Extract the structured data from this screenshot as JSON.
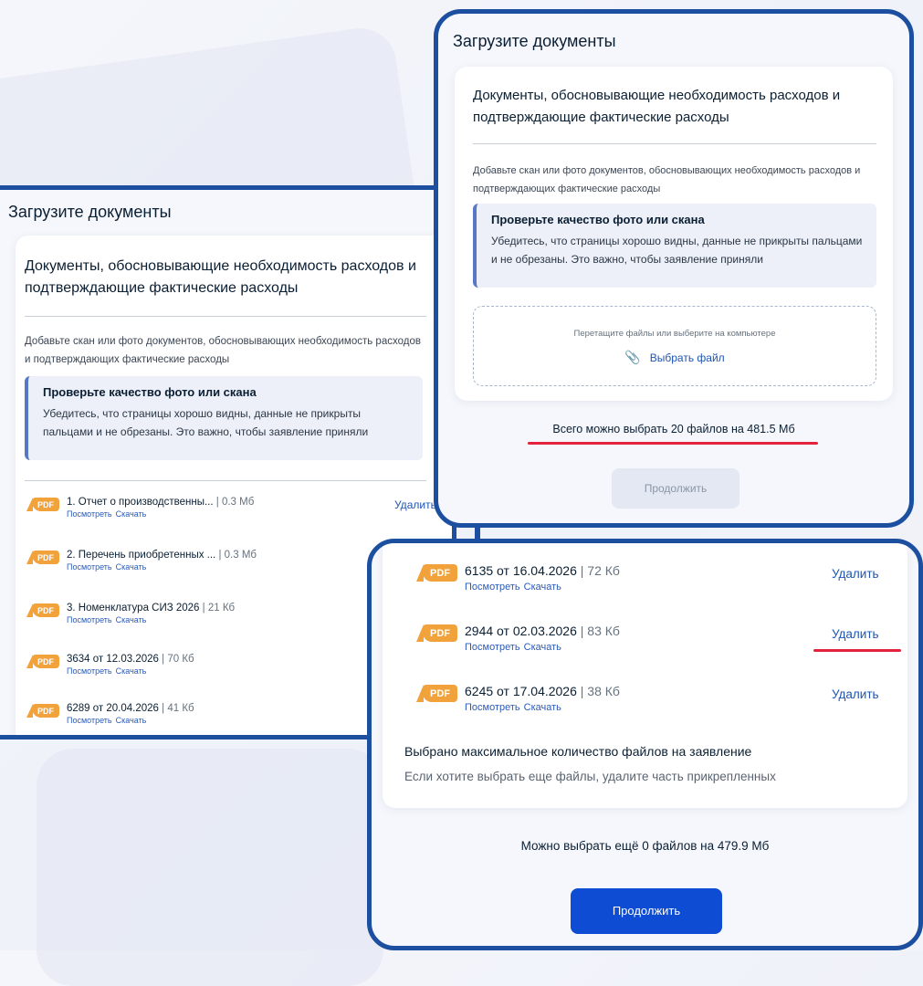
{
  "left_panel": {
    "title": "Загрузите документы",
    "subtitle": "Документы, обосновывающие необходимость расходов и подтверждающие фактические расходы",
    "description": "Добавьте скан или фото документов, обосновывающих необходимость расходов и подтверждающих фактические расходы",
    "notice": {
      "title": "Проверьте качество фото или скана",
      "text": "Убедитесь, что страницы хорошо видны, данные не прикрыты пальцами и не обрезаны. Это важно, чтобы заявление приняли"
    },
    "files": [
      {
        "badge": "PDF",
        "name": "1. Отчет о производственны...",
        "size": " | 0.3 Мб",
        "view": "Посмотреть",
        "download": "Скачать",
        "delete": "Удалить"
      },
      {
        "badge": "PDF",
        "name": "2. Перечень приобретенных ...",
        "size": " | 0.3 Мб",
        "view": "Посмотреть",
        "download": "Скачать"
      },
      {
        "badge": "PDF",
        "name": "3. Номенклатура СИЗ 2026",
        "size": " | 21 Кб",
        "view": "Посмотреть",
        "download": "Скачать"
      },
      {
        "badge": "PDF",
        "name": "3634 от 12.03.2026",
        "size": " | 70 Кб",
        "view": "Посмотреть",
        "download": "Скачать"
      },
      {
        "badge": "PDF",
        "name": "6289 от 20.04.2026",
        "size": " | 41 Кб",
        "view": "Посмотреть",
        "download": "Скачать"
      }
    ]
  },
  "top_panel": {
    "title": "Загрузите документы",
    "subtitle": "Документы, обосновывающие необходимость расходов и подтверждающие фактические расходы",
    "description": "Добавьте скан или фото документов, обосновывающих необходимость расходов и подтверждающих фактические расходы",
    "notice": {
      "title": "Проверьте качество фото или скана",
      "text": "Убедитесь, что страницы хорошо видны, данные не прикрыты пальцами и не обрезаны. Это важно, чтобы заявление приняли"
    },
    "dropzone": {
      "hint": "Перетащите файлы или выберите на компьютере",
      "link": "Выбрать файл"
    },
    "limit": "Всего можно выбрать 20 файлов на 481.5 Мб",
    "continue": "Продолжить"
  },
  "bottom_panel": {
    "files": [
      {
        "badge": "PDF",
        "name": "6135 от 16.04.2026",
        "size": " | 72 Кб",
        "view": "Посмотреть",
        "download": "Скачать",
        "delete": "Удалить"
      },
      {
        "badge": "PDF",
        "name": "2944 от 02.03.2026",
        "size": " | 83 Кб",
        "view": "Посмотреть",
        "download": "Скачать",
        "delete": "Удалить"
      },
      {
        "badge": "PDF",
        "name": "6245 от 17.04.2026",
        "size": " | 38 Кб",
        "view": "Посмотреть",
        "download": "Скачать",
        "delete": "Удалить"
      }
    ],
    "max_title": "Выбрано максимальное количество файлов на заявление",
    "max_text": "Если хотите выбрать еще файлы, удалите часть прикрепленных",
    "remaining": "Можно выбрать ещё 0 файлов на 479.9 Мб",
    "continue": "Продолжить"
  },
  "colors": {
    "frame": "#1d4fa0",
    "highlight": "#e3223d",
    "primary": "#0d4cd3",
    "pdf": "#f2a23a"
  }
}
